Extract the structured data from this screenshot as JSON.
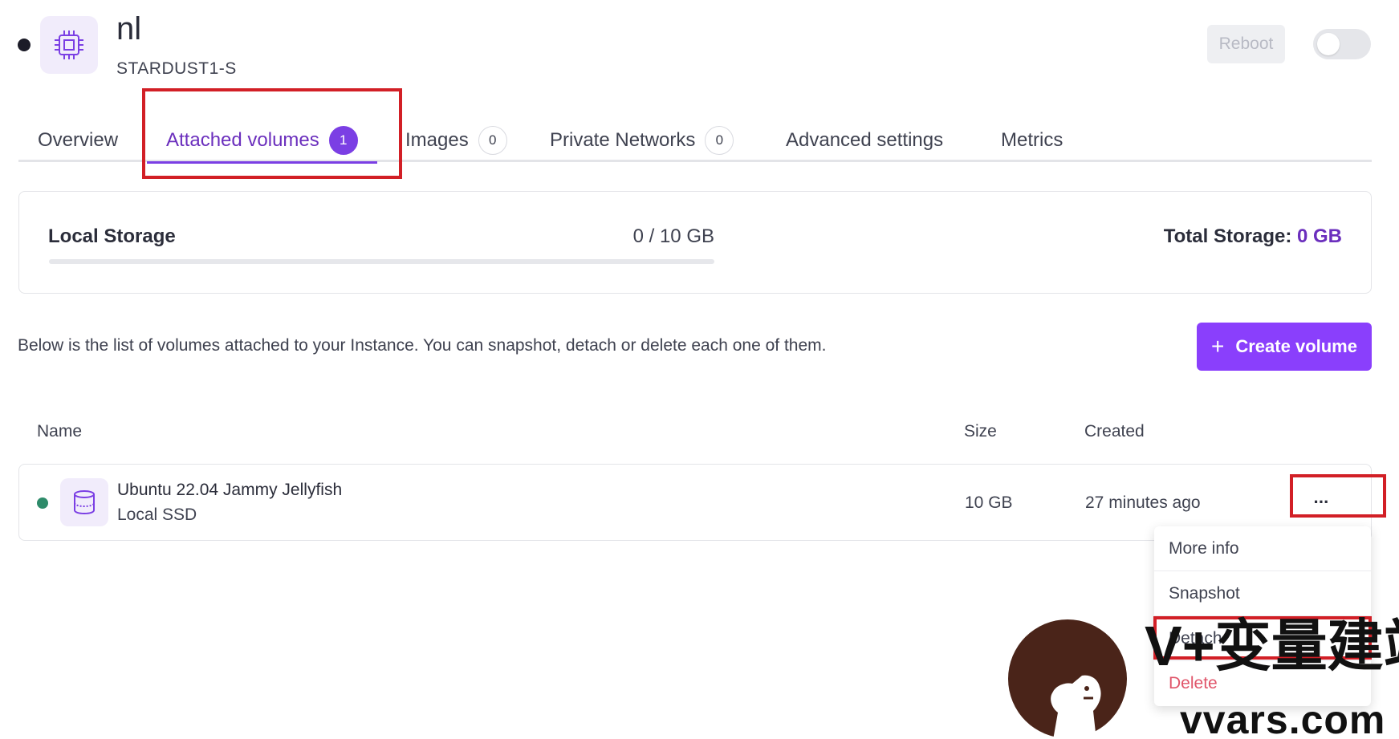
{
  "instance": {
    "name": "nl",
    "type": "STARDUST1-S",
    "reboot_label": "Reboot",
    "power_on": false
  },
  "tabs": [
    {
      "label": "Overview",
      "count": null,
      "active": false
    },
    {
      "label": "Attached volumes",
      "count": "1",
      "active": true
    },
    {
      "label": "Images",
      "count": "0",
      "active": false
    },
    {
      "label": "Private Networks",
      "count": "0",
      "active": false
    },
    {
      "label": "Advanced settings",
      "count": null,
      "active": false
    },
    {
      "label": "Metrics",
      "count": null,
      "active": false
    }
  ],
  "storage": {
    "label": "Local Storage",
    "usage": "0 / 10 GB",
    "used_fraction": 0,
    "total_label": "Total Storage:",
    "total_value": "0 GB"
  },
  "description": "Below is the list of volumes attached to your Instance. You can snapshot, detach or delete each one of them.",
  "create_button": {
    "icon": "+",
    "label": "Create volume"
  },
  "table": {
    "headers": {
      "name": "Name",
      "size": "Size",
      "created": "Created"
    },
    "rows": [
      {
        "name": "Ubuntu 22.04 Jammy Jellyfish",
        "type": "Local SSD",
        "size": "10 GB",
        "created": "27 minutes ago",
        "status_color": "#2e8b6a"
      }
    ]
  },
  "more_button": "···",
  "menu": {
    "items": [
      "More info",
      "Snapshot",
      "Detach",
      "Delete"
    ]
  },
  "watermark": {
    "text": "V+变量建站",
    "url": "vvars.com"
  },
  "colors": {
    "accent": "#7b3fe4",
    "primary_button": "#8a3ffc",
    "highlight_box": "#d21f26",
    "status_ok": "#2e8b6a"
  }
}
